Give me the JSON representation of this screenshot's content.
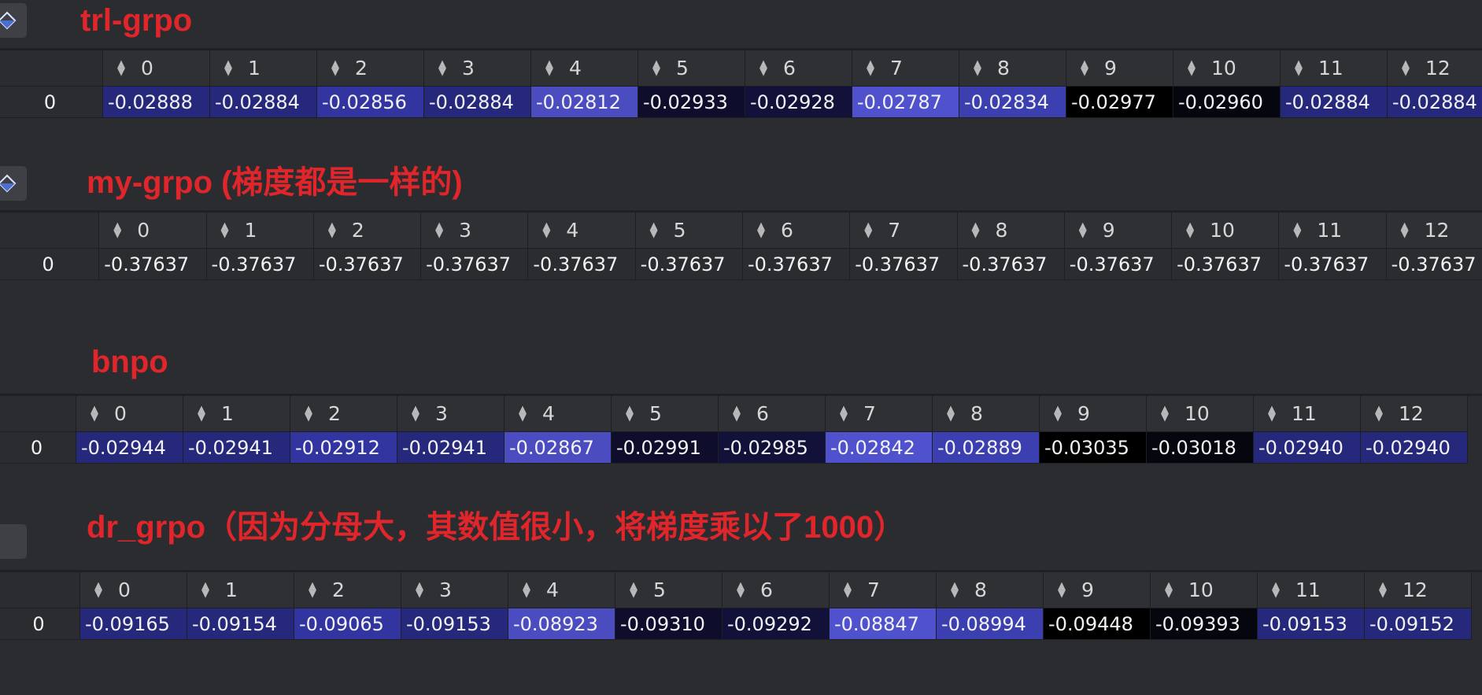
{
  "columns": [
    "0",
    "1",
    "2",
    "3",
    "4",
    "5",
    "6",
    "7",
    "8",
    "9",
    "10",
    "11",
    "12"
  ],
  "sections": [
    {
      "title": "trl-grpo",
      "row_index": "0",
      "values": [
        "-0.02888",
        "-0.02884",
        "-0.02856",
        "-0.02884",
        "-0.02812",
        "-0.02933",
        "-0.02928",
        "-0.02787",
        "-0.02834",
        "-0.02977",
        "-0.02960",
        "-0.02884",
        "-0.02884"
      ],
      "colors": [
        "#26287c",
        "#26287c",
        "#3235a0",
        "#26287c",
        "#4a4cc0",
        "#0e0e2c",
        "#11113a",
        "#4f52cc",
        "#3c3fb0",
        "#000000",
        "#06060f",
        "#26287c",
        "#26287c"
      ]
    },
    {
      "title": "my-grpo (梯度都是一样的)",
      "row_index": "0",
      "values": [
        "-0.37637",
        "-0.37637",
        "-0.37637",
        "-0.37637",
        "-0.37637",
        "-0.37637",
        "-0.37637",
        "-0.37637",
        "-0.37637",
        "-0.37637",
        "-0.37637",
        "-0.37637",
        "-0.37637"
      ],
      "colors": [
        "#2b2c30",
        "#2b2c30",
        "#2b2c30",
        "#2b2c30",
        "#2b2c30",
        "#2b2c30",
        "#2b2c30",
        "#2b2c30",
        "#2b2c30",
        "#2b2c30",
        "#2b2c30",
        "#2b2c30",
        "#2b2c30"
      ]
    },
    {
      "title": "bnpo",
      "row_index": "0",
      "values": [
        "-0.02944",
        "-0.02941",
        "-0.02912",
        "-0.02941",
        "-0.02867",
        "-0.02991",
        "-0.02985",
        "-0.02842",
        "-0.02889",
        "-0.03035",
        "-0.03018",
        "-0.02940",
        "-0.02940"
      ],
      "colors": [
        "#26287c",
        "#26287c",
        "#3235a0",
        "#26287c",
        "#4a4cc0",
        "#0e0e2c",
        "#11113a",
        "#4f52cc",
        "#3c3fb0",
        "#000000",
        "#06060f",
        "#26287c",
        "#26287c"
      ]
    },
    {
      "title": "dr_grpo（因为分母大，其数值很小，将梯度乘以了1000）",
      "row_index": "0",
      "values": [
        "-0.09165",
        "-0.09154",
        "-0.09065",
        "-0.09153",
        "-0.08923",
        "-0.09310",
        "-0.09292",
        "-0.08847",
        "-0.08994",
        "-0.09448",
        "-0.09393",
        "-0.09153",
        "-0.09152"
      ],
      "colors": [
        "#26287c",
        "#26287c",
        "#3235a0",
        "#26287c",
        "#4a4cc0",
        "#0e0e2c",
        "#11113a",
        "#4f52cc",
        "#3c3fb0",
        "#000000",
        "#06060f",
        "#26287c",
        "#26287c"
      ]
    }
  ]
}
